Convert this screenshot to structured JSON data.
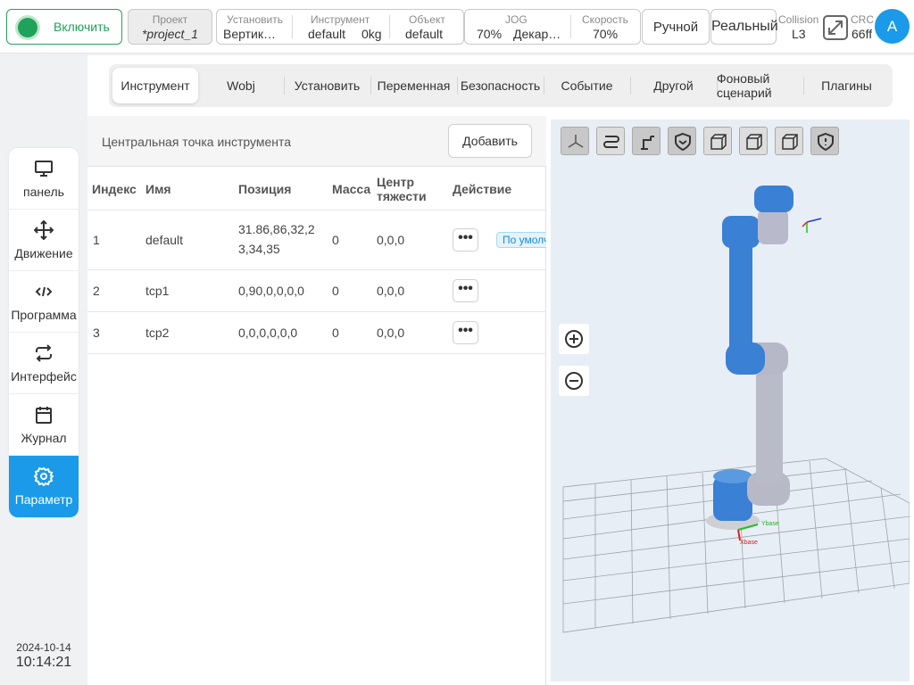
{
  "header": {
    "enable_label": "Включить",
    "project_label": "Проект",
    "project_value": "*project_1",
    "setup_label": "Установить",
    "setup_value": "Вертик…",
    "tool_label": "Инструмент",
    "tool_value": "default",
    "tool_mass": "0kg",
    "object_label": "Объект",
    "object_value": "default",
    "jog_label": "JOG",
    "jog_value": "70%",
    "jog_coord": "Декар…",
    "speed_label": "Скорость",
    "speed_value": "70%",
    "manual_button": "Ручной",
    "real_button": "Реальный",
    "collision_label": "Collision",
    "collision_value": "L3",
    "crc_label": "CRC",
    "crc_value": "66ff",
    "avatar_letter": "A",
    "status_color": "#1fa25a",
    "accent_color": "#1a9ae8"
  },
  "sidebar": {
    "items": [
      {
        "label": "панель",
        "icon": "monitor-icon"
      },
      {
        "label": "Движение",
        "icon": "move-icon"
      },
      {
        "label": "Программа",
        "icon": "code-icon"
      },
      {
        "label": "Интерфейс",
        "icon": "repeat-icon"
      },
      {
        "label": "Журнал",
        "icon": "calendar-icon"
      },
      {
        "label": "Параметр",
        "icon": "gear-icon"
      }
    ],
    "date": "2024-10-14",
    "time": "10:14:21"
  },
  "tabs": [
    "Инструмент",
    "Wobj",
    "Установить",
    "Переменная",
    "Безопасность",
    "Событие",
    "Другой",
    "Фоновый сценарий",
    "Плагины"
  ],
  "tcp": {
    "title": "Центральная точка инструмента",
    "add_button": "Добавить",
    "columns": [
      "Индекс",
      "Имя",
      "Позиция",
      "Масса",
      "Центр тяжести",
      "Действие"
    ],
    "rows": [
      {
        "index": "1",
        "name": "default",
        "position": "31.86,86,32,23,34,35",
        "mass": "0",
        "cog": "0,0,0",
        "badge": "По умолчанию"
      },
      {
        "index": "2",
        "name": "tcp1",
        "position": "0,90,0,0,0,0",
        "mass": "0",
        "cog": "0,0,0"
      },
      {
        "index": "3",
        "name": "tcp2",
        "position": "0,0,0,0,0,0",
        "mass": "0",
        "cog": "0,0,0"
      }
    ],
    "action_glyph": "•••"
  },
  "viewer": {
    "tools": [
      "axes-icon",
      "path-icon",
      "robot-icon",
      "shield-check-icon",
      "cube-front-icon",
      "cube-side-icon",
      "cube-iso-icon",
      "shield-alert-icon"
    ],
    "axis_x_label": "Xbase",
    "axis_y_label": "Ybase",
    "robot_color": "#3a80d4"
  }
}
